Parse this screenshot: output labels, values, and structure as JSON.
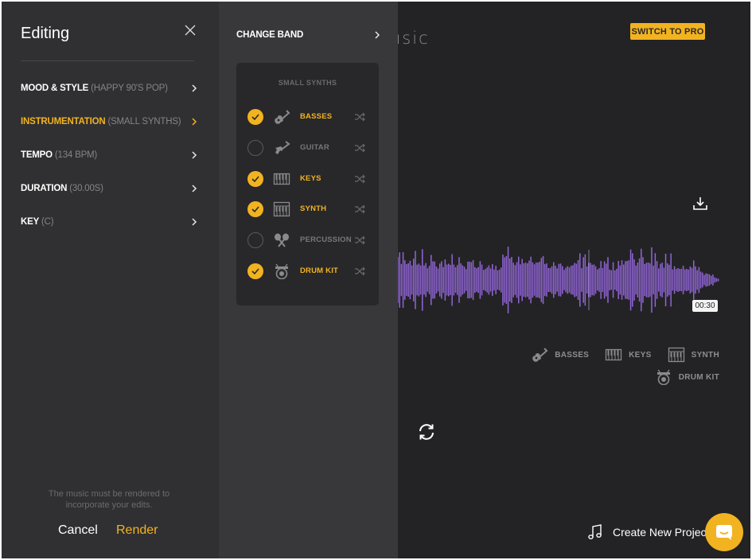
{
  "main": {
    "title_fragment": "usic",
    "pro_button": "SWITCH TO PRO",
    "time_badge": "00:30",
    "legend": [
      {
        "name": "BASSES",
        "icon": "guitar-icon"
      },
      {
        "name": "KEYS",
        "icon": "keys-icon"
      },
      {
        "name": "SYNTH",
        "icon": "synth-icon"
      },
      {
        "name": "DRUM KIT",
        "icon": "drum-icon"
      }
    ],
    "create_project": "Create New Project"
  },
  "sidebar": {
    "title": "Editing",
    "items": [
      {
        "label": "MOOD & STYLE",
        "value": "(HAPPY 90'S POP)",
        "active": false
      },
      {
        "label": "INSTRUMENTATION",
        "value": "(SMALL SYNTHS)",
        "active": true
      },
      {
        "label": "TEMPO",
        "value": "(134 BPM)",
        "active": false
      },
      {
        "label": "DURATION",
        "value": "(30.00S)",
        "active": false
      },
      {
        "label": "KEY",
        "value": "(C)",
        "active": false
      }
    ],
    "note": "The music must be rendered to incorporate your edits.",
    "cancel": "Cancel",
    "render": "Render"
  },
  "band": {
    "change_band": "CHANGE BAND",
    "card_title": "SMALL SYNTHS",
    "instruments": [
      {
        "name": "BASSES",
        "selected": true,
        "icon": "guitar-icon"
      },
      {
        "name": "GUITAR",
        "selected": false,
        "icon": "electric-guitar-icon"
      },
      {
        "name": "KEYS",
        "selected": true,
        "icon": "keys-icon"
      },
      {
        "name": "SYNTH",
        "selected": true,
        "icon": "synth-icon"
      },
      {
        "name": "PERCUSSION",
        "selected": false,
        "icon": "maracas-icon"
      },
      {
        "name": "DRUM KIT",
        "selected": true,
        "icon": "drum-icon"
      }
    ]
  },
  "colors": {
    "accent": "#f2b320",
    "waveform": "#9165d6",
    "background": "#232325",
    "sidebar": "#303032",
    "panel": "#38383a"
  }
}
